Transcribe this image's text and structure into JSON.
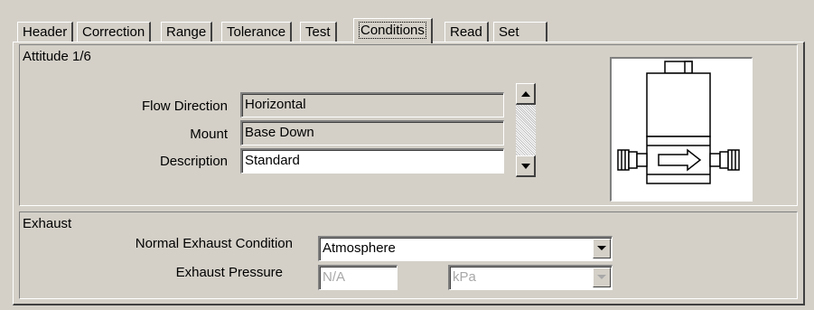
{
  "tabs": [
    {
      "label": "Header"
    },
    {
      "label": "Correction"
    },
    {
      "label": "Range"
    },
    {
      "label": "Tolerance"
    },
    {
      "label": "Test"
    },
    {
      "label": "Conditions",
      "active": true
    },
    {
      "label": "Read"
    },
    {
      "label": "Set"
    }
  ],
  "attitude": {
    "title": "Attitude 1/6",
    "flow_direction_label": "Flow Direction",
    "flow_direction_value": "Horizontal",
    "mount_label": "Mount",
    "mount_value": "Base Down",
    "description_label": "Description",
    "description_value": "Standard"
  },
  "icons": {
    "up": "scroll-up-arrow-icon",
    "down": "scroll-down-arrow-icon",
    "device": "flow-device-diagram-icon"
  },
  "exhaust": {
    "title": "Exhaust",
    "normal_condition_label": "Normal Exhaust Condition",
    "normal_condition_value": "Atmosphere",
    "pressure_label": "Exhaust Pressure",
    "pressure_value": "N/A",
    "pressure_unit": "kPa"
  }
}
